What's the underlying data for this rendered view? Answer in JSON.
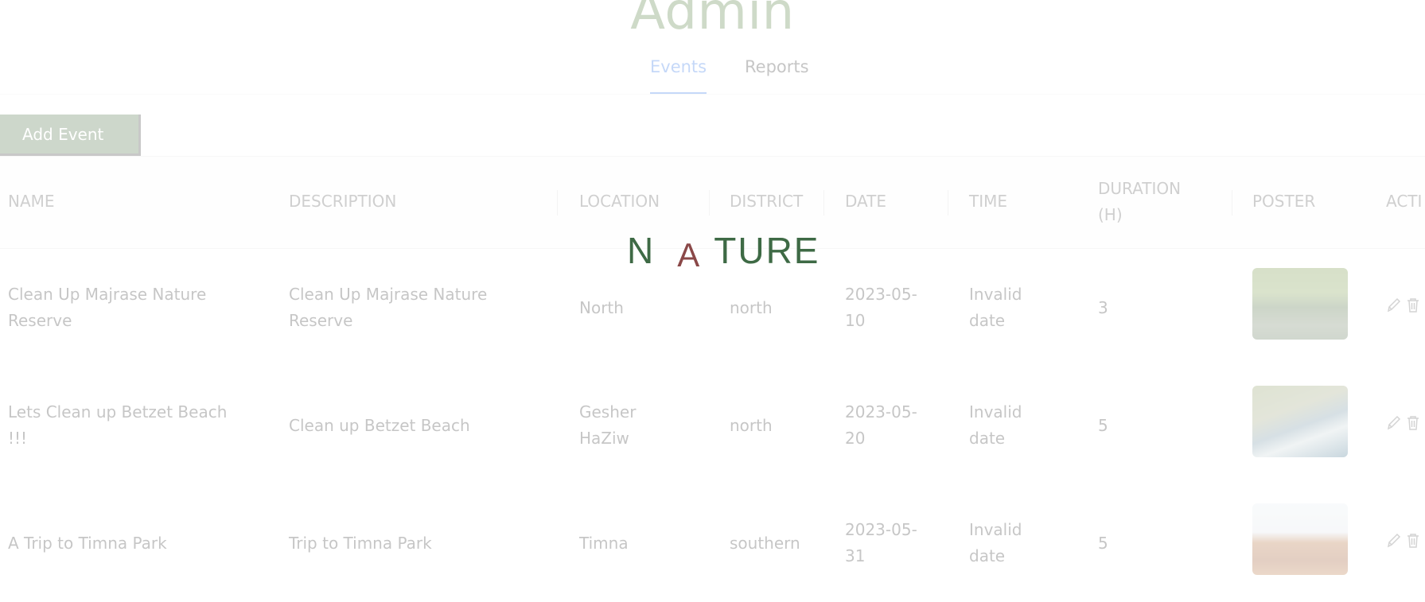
{
  "header": {
    "title": "Admin",
    "tabs": [
      {
        "label": "Events",
        "active": true
      },
      {
        "label": "Reports",
        "active": false
      }
    ]
  },
  "toolbar": {
    "add_event_label": "Add Event"
  },
  "table": {
    "columns": [
      "NAME",
      "DESCRIPTION",
      "LOCATION",
      "DISTRICT",
      "DATE",
      "TIME",
      "DURATION (H)",
      "POSTER",
      "ACTI"
    ],
    "rows": [
      {
        "name": "Clean Up Majrase Nature Reserve",
        "description": "Clean Up Majrase Nature Reserve",
        "location": "North",
        "district": "north",
        "date": "2023-05-10",
        "time": "Invalid date",
        "duration": "3"
      },
      {
        "name": "Lets Clean up Betzet Beach !!!",
        "description": "Clean up Betzet Beach",
        "location": "Gesher HaZiw",
        "district": "north",
        "date": "2023-05-20",
        "time": "Invalid date",
        "duration": "5"
      },
      {
        "name": "A Trip to Timna Park",
        "description": "Trip to Timna Park",
        "location": "Timna",
        "district": "southern",
        "date": "2023-05-31",
        "time": "Invalid date",
        "duration": "5"
      }
    ]
  },
  "logo": {
    "part1": "N",
    "part2": "A",
    "part3": "TURE"
  },
  "colors": {
    "accent_green": "#4d7044",
    "tab_active": "#2f74e6",
    "logo_green": "#3e6a45",
    "logo_red": "#8a4848"
  },
  "icons": [
    "pencil-icon",
    "trash-icon"
  ]
}
